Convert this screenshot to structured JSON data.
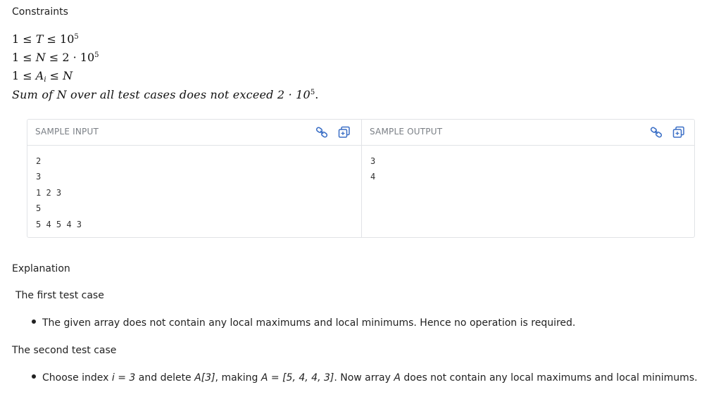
{
  "constraints": {
    "heading": "Constraints",
    "lines": [
      {
        "pre": "1 ≤ ",
        "var": "T",
        "post": " ≤ 10",
        "sup": "5"
      },
      {
        "pre": "1 ≤ ",
        "var": "N",
        "post": " ≤ 2 · 10",
        "sup": "5"
      },
      {
        "pre": "1 ≤ ",
        "var": "A",
        "sub": "i",
        "post": " ≤ ",
        "var2": "N"
      }
    ],
    "sum_text": "Sum of N over all test cases does not exceed 2 · 10",
    "sum_sup": "5",
    "sum_end": "."
  },
  "sample_input": {
    "title": "SAMPLE INPUT",
    "link_icon": "link-icon",
    "copy_icon": "copy-icon",
    "lines": [
      "2",
      "3",
      "1 2 3",
      "5",
      "5 4 5 4 3"
    ]
  },
  "sample_output": {
    "title": "SAMPLE OUTPUT",
    "link_icon": "link-icon",
    "copy_icon": "copy-icon",
    "lines": [
      "3",
      "4"
    ]
  },
  "explanation": {
    "heading": "Explanation",
    "first_case": {
      "title": "The first test case",
      "bullet": "The given array does not contain any local maximums and local minimums. Hence no operation is required."
    },
    "second_case": {
      "title": "The second test case",
      "bullet_parts": {
        "p1": "Choose index ",
        "i1": "i = 3",
        "p2": " and delete ",
        "i2": "A[3]",
        "p3": ", making ",
        "i3": "A = [5, 4, 4, 3]",
        "p4": ". Now array ",
        "i4": "A",
        "p5": " does not contain any local maximums and local minimums."
      }
    }
  },
  "colors": {
    "icon": "#3b6fc6",
    "border": "#e1e3e6",
    "muted": "#7a7f85"
  }
}
